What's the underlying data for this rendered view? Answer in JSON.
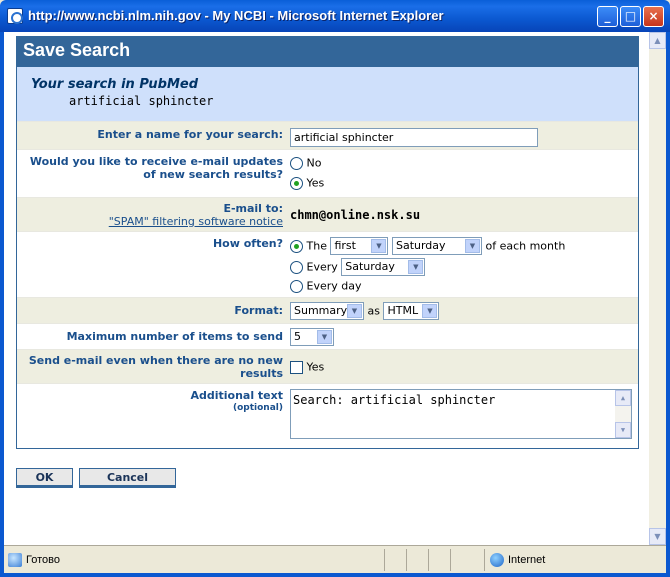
{
  "window": {
    "title": "http://www.ncbi.nlm.nih.gov - My NCBI - Microsoft Internet Explorer",
    "min_glyph": "_",
    "max_glyph": "□",
    "close_glyph": "×"
  },
  "dialog": {
    "header": "Save Search",
    "search_title": "Your search in PubMed",
    "search_query": "artificial sphincter"
  },
  "fields": {
    "name_label": "Enter a name for your search:",
    "name_value": "artificial sphincter",
    "updates_label": "Would you like to receive e-mail updates of new search results?",
    "updates_no": "No",
    "updates_yes": "Yes",
    "email_label": "E-mail to:",
    "spam_notice": "\"SPAM\" filtering software notice",
    "email_value": "chmn@online.nsk.su",
    "howoften_label": "How often?",
    "howoften_the": "The",
    "howoften_ordinal": "first",
    "howoften_day": "Saturday",
    "howoften_suffix": "of each month",
    "howoften_every": "Every",
    "howoften_every_day_value": "Saturday",
    "howoften_everyday": "Every day",
    "format_label": "Format:",
    "format_value": "Summary",
    "format_as": "as",
    "format_type": "HTML",
    "maxitems_label": "Maximum number of items to send",
    "maxitems_value": "5",
    "sendempty_label": "Send e-mail even when there are no new results",
    "sendempty_yes": "Yes",
    "additional_label": "Additional text",
    "additional_optional": "(optional)",
    "additional_value": "Search: artificial sphincter"
  },
  "buttons": {
    "ok": "OK",
    "cancel": "Cancel"
  },
  "status": {
    "text": "Готово",
    "zone": "Internet"
  }
}
